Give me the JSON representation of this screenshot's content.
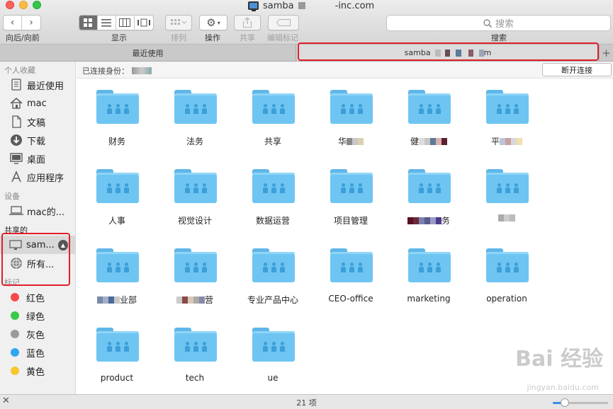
{
  "window": {
    "title_left": "samba",
    "title_right": "-inc.com",
    "traffic_lights": [
      "close",
      "minimize",
      "zoom"
    ]
  },
  "toolbar": {
    "nav_label": "向后/向前",
    "view_label": "显示",
    "arrange_label": "排列",
    "action_label": "操作",
    "share_label": "共享",
    "tags_label": "编辑标记",
    "search_label": "搜索",
    "search_placeholder": "搜索"
  },
  "tabs": {
    "inactive": "最近使用",
    "active_prefix": "samba",
    "active_suffix": "m",
    "new_tab": "+"
  },
  "sidebar": {
    "favorites_header": "个人收藏",
    "favorites": [
      {
        "label": "最近使用",
        "icon": "recents-icon"
      },
      {
        "label": "mac",
        "icon": "home-icon"
      },
      {
        "label": "文稿",
        "icon": "documents-icon"
      },
      {
        "label": "下载",
        "icon": "downloads-icon"
      },
      {
        "label": "桌面",
        "icon": "desktop-icon"
      },
      {
        "label": "应用程序",
        "icon": "applications-icon"
      }
    ],
    "devices_header": "设备",
    "devices": [
      {
        "label": "mac的...",
        "icon": "laptop-icon"
      }
    ],
    "shared_header": "共享的",
    "shared": [
      {
        "label": "sam...",
        "icon": "monitor-icon"
      },
      {
        "label": "所有...",
        "icon": "network-icon"
      }
    ],
    "tags_header": "标记",
    "tags": [
      {
        "label": "红色",
        "color": "#f64a4a"
      },
      {
        "label": "绿色",
        "color": "#3ac84a"
      },
      {
        "label": "灰色",
        "color": "#9a9a9a"
      },
      {
        "label": "蓝色",
        "color": "#2fa6f0"
      },
      {
        "label": "黄色",
        "color": "#f9c72c"
      }
    ]
  },
  "pathbar": {
    "connected_as": "已连接身份：",
    "disconnect": "断开连接"
  },
  "folders": [
    "财务",
    "法务",
    "共享",
    "华",
    "健",
    "平",
    "人事",
    "视觉设计",
    "数据运营",
    "项目管理",
    "务",
    "",
    "业部",
    "营",
    "专业产品中心",
    "CEO-office",
    "marketing",
    "operation",
    "product",
    "tech",
    "ue"
  ],
  "status": {
    "count": "21 项",
    "zoom_level": 0.22
  },
  "watermark": {
    "text": "Bai 经验",
    "sub": "jingyan.baidu.com"
  }
}
